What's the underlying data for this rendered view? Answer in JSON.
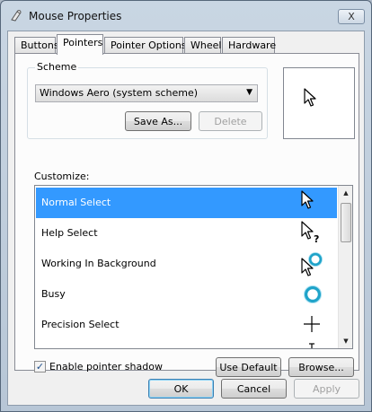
{
  "window": {
    "title": "Mouse Properties",
    "close_glyph": "X"
  },
  "tabs": [
    {
      "label": "Buttons",
      "active": false
    },
    {
      "label": "Pointers",
      "active": true
    },
    {
      "label": "Pointer Options",
      "active": false
    },
    {
      "label": "Wheel",
      "active": false
    },
    {
      "label": "Hardware",
      "active": false
    }
  ],
  "scheme": {
    "group_label": "Scheme",
    "selected": "Windows Aero (system scheme)",
    "save_as_label": "Save As...",
    "delete_label": "Delete"
  },
  "customize": {
    "label": "Customize:",
    "items": [
      {
        "label": "Normal Select",
        "selected": true,
        "icon": "arrow-cursor-icon"
      },
      {
        "label": "Help Select",
        "selected": false,
        "icon": "help-cursor-icon"
      },
      {
        "label": "Working In Background",
        "selected": false,
        "icon": "working-cursor-icon"
      },
      {
        "label": "Busy",
        "selected": false,
        "icon": "busy-cursor-icon"
      },
      {
        "label": "Precision Select",
        "selected": false,
        "icon": "crosshair-cursor-icon"
      },
      {
        "label": "",
        "selected": false,
        "icon": "text-cursor-icon"
      }
    ]
  },
  "shadow": {
    "label": "Enable pointer shadow",
    "checked": true
  },
  "buttons": {
    "use_default": "Use Default",
    "browse": "Browse...",
    "ok": "OK",
    "cancel": "Cancel",
    "apply": "Apply"
  },
  "colors": {
    "selection": "#3399ff",
    "busy_ring": "#1fa3c9"
  }
}
